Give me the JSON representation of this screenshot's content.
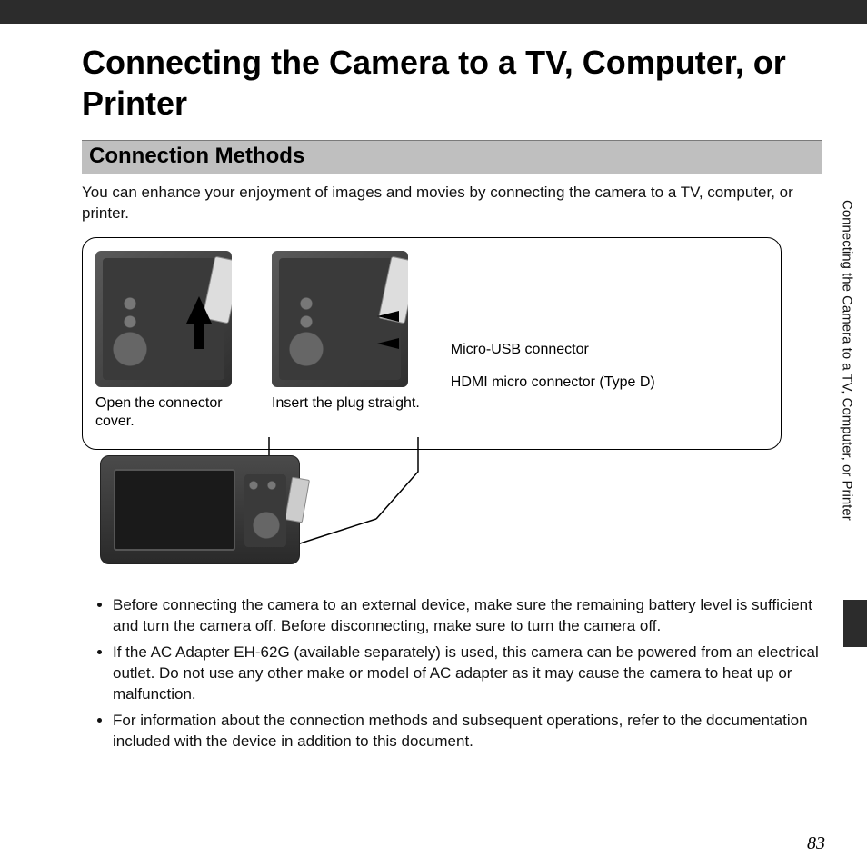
{
  "page": {
    "title": "Connecting the Camera to a TV, Computer, or Printer",
    "number": "83",
    "side_tab": "Connecting the Camera to a TV, Computer, or Printer"
  },
  "section": {
    "heading": "Connection Methods",
    "intro": "You can enhance your enjoyment of images and movies by connecting the camera to a TV, computer, or printer."
  },
  "diagram": {
    "caption_left": "Open the connector cover.",
    "caption_right": "Insert the plug straight.",
    "label_usb": "Micro-USB connector",
    "label_hdmi": "HDMI micro connector (Type D)"
  },
  "notes": [
    "Before connecting the camera to an external device, make sure the remaining battery level is sufficient and turn the camera off. Before disconnecting, make sure to turn the camera off.",
    "If the AC Adapter EH-62G (available separately) is used, this camera can be powered from an electrical outlet. Do not use any other make or model of AC adapter as it may cause the camera to heat up or malfunction.",
    "For information about the connection methods and subsequent operations, refer to the documentation included with the device in addition to this document."
  ]
}
